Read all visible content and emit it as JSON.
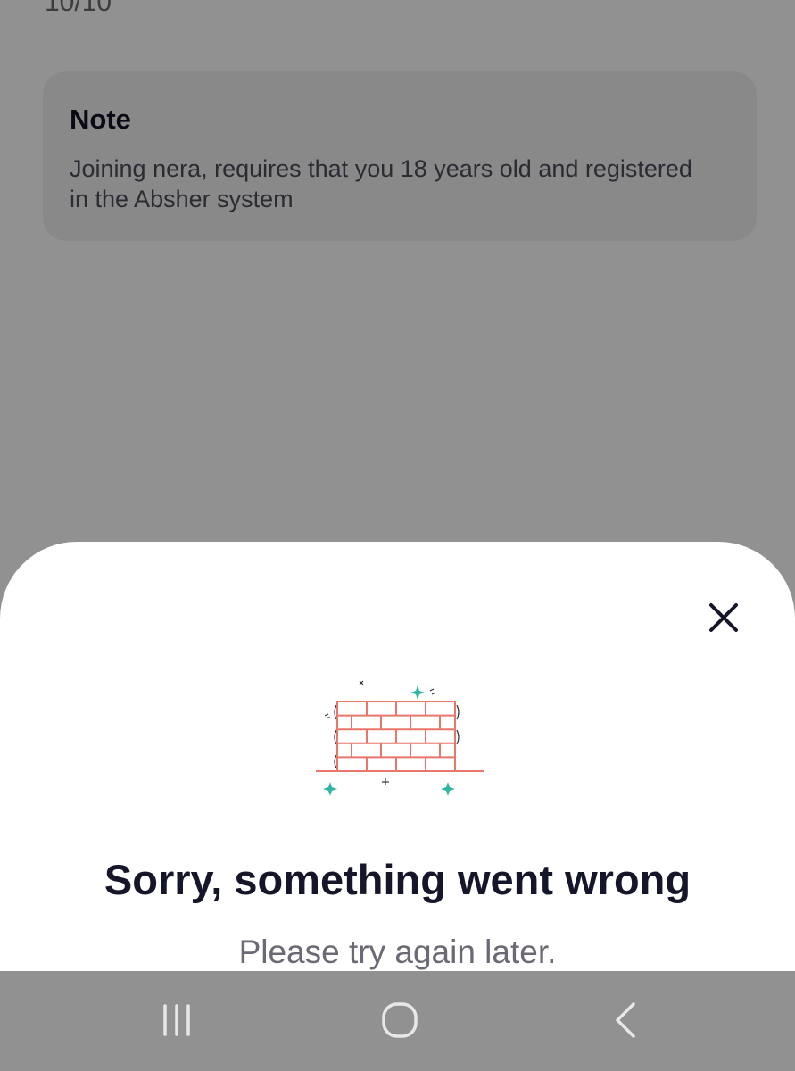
{
  "progress": {
    "counter_text": "10/10"
  },
  "note": {
    "title": "Note",
    "body": "Joining nera, requires that you 18 years old and registered in the Absher system"
  },
  "error_sheet": {
    "title": "Sorry, something went wrong",
    "subtitle": "Please try again later.",
    "illustration": "brick-wall-illustration",
    "close_icon": "close-icon"
  },
  "navbar": {
    "icons": [
      "recent-apps-icon",
      "home-icon",
      "back-icon"
    ]
  },
  "colors": {
    "scrim": "#919191",
    "sheet_background": "#ffffff",
    "title_text": "#16162a",
    "subtitle_text": "#6a6a74",
    "brick": "#e8766b",
    "sparkle": "#2fb5a0"
  }
}
